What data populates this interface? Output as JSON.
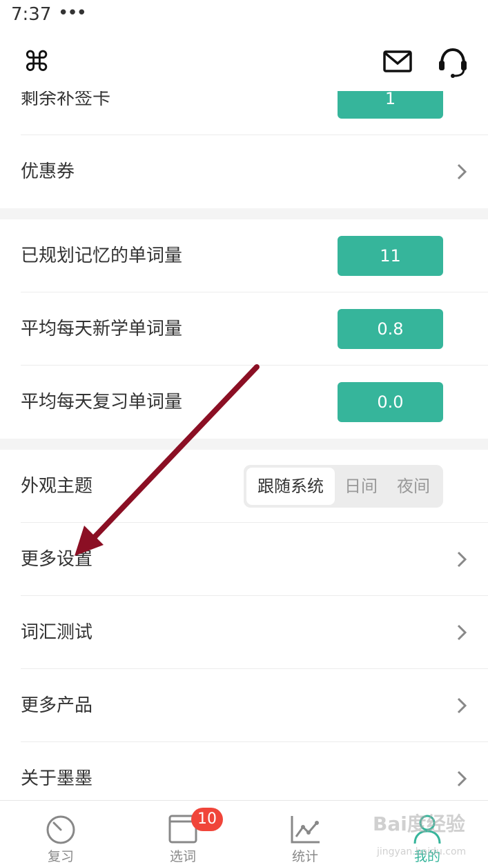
{
  "status_bar": {
    "time": "7:37",
    "dots": "•••"
  },
  "app_bar": {
    "left_icon": "command-icon",
    "right_icons": [
      "mail-icon",
      "headset-icon"
    ]
  },
  "sections": {
    "top": {
      "remaining_makeup_cards": {
        "label": "剩余补签卡",
        "value": "1"
      },
      "coupons": {
        "label": "优惠券"
      }
    },
    "stats": {
      "planned_words": {
        "label": "已规划记忆的单词量",
        "value": "11"
      },
      "avg_new": {
        "label": "平均每天新学单词量",
        "value": "0.8"
      },
      "avg_review": {
        "label": "平均每天复习单词量",
        "value": "0.0"
      }
    },
    "settings": {
      "theme": {
        "label": "外观主题",
        "options": [
          "跟随系统",
          "日间",
          "夜间"
        ],
        "selected": "跟随系统"
      },
      "more_settings": {
        "label": "更多设置"
      },
      "vocab_test": {
        "label": "词汇测试"
      },
      "more_products": {
        "label": "更多产品"
      },
      "about": {
        "label": "关于墨墨"
      }
    }
  },
  "tab_bar": {
    "review": {
      "label": "复习"
    },
    "select_words": {
      "label": "选词",
      "badge": "10"
    },
    "statistics": {
      "label": "统计"
    },
    "mine": {
      "label": "我的",
      "active": true
    }
  },
  "watermark": {
    "line1": "Bai度经验",
    "line2": "jingyan.baidu.com"
  },
  "colors": {
    "accent": "#36b59b",
    "badge": "#f0453a",
    "annotation_arrow": "#8b0f24"
  }
}
